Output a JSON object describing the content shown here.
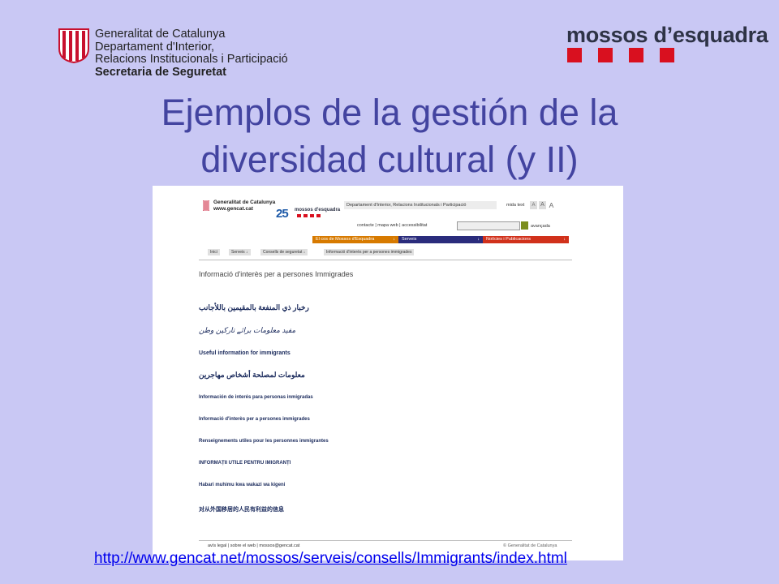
{
  "header": {
    "org_lines": [
      "Generalitat de Catalunya",
      "Departament d'Interior,",
      "Relacions Institucionals i Participació"
    ],
    "org_bold": "Secretaria de Seguretat",
    "brand": "mossos d’esquadra"
  },
  "title": {
    "line1": "Ejemplos de la gestión de la",
    "line2": "diversidad cultural (y II)"
  },
  "screenshot": {
    "logo_line1": "Generalitat de Catalunya",
    "logo_line2": "www.gencat.cat",
    "anniv": "25",
    "brand": "mossos d'esquadra",
    "dept": "Departament d'Interior, Relacions Institucionals i Participació",
    "text_size_label": "mida text",
    "sizes": [
      "A",
      "A",
      "A"
    ],
    "links": "contacte | mapa web | accessibilitat",
    "advanced": "avançada",
    "menu": [
      {
        "label": "El cos de Mossos d'Esquadra",
        "arrow": "↓",
        "color": "#d77a00"
      },
      {
        "label": "Serveis",
        "arrow": "↓",
        "color": "#2a2c7c"
      },
      {
        "label": "Notícies i Publicacions",
        "arrow": "↓",
        "color": "#d1311b"
      }
    ],
    "breadcrumb": [
      "Inici",
      "Serveis ↓",
      "Consells de seguretat ↓",
      "Informació d'interès per a persones immigrades"
    ],
    "heading": "Informació d'interès per a persones Immigrades",
    "items": [
      "رخبار ذي المنفعة بالمقيمين باللأجانب",
      "مفید معلومات برائے تارکین وطن",
      "Useful information for immigrants",
      "معلومات لمصلحة أشخاص مهاجرين",
      "Información de interés para personas inmigradas",
      "Informació d'interès per a persones immigrades",
      "Renseignements utiles pour les personnes immigrantes",
      "INFORMAȚII UTILE PENTRU IMIGRANȚI",
      "Habari muhimu kwa wakazi wa kigeni",
      "对从外国移居的人民有利益的信息"
    ],
    "footer_left": "avís legal | sobre el web | mossos@gencat.cat",
    "footer_right": "© Generalitat de Catalunya"
  },
  "url": "http://www.gencat.net/mossos/serveis/consells/Immigrants/index.html",
  "colors": {
    "background": "#c9c8f4",
    "title": "#4344a0",
    "brand_red": "#d9101f",
    "link": "#0000ee"
  }
}
